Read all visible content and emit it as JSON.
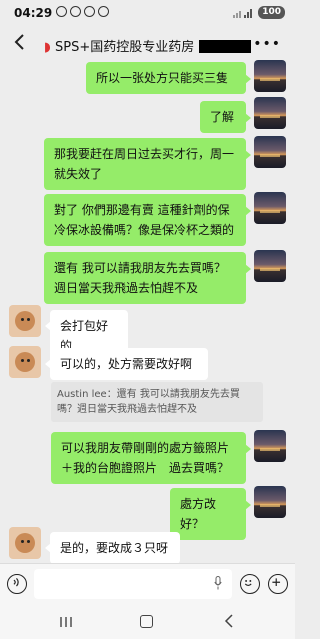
{
  "status_bar": {
    "time": "04:29",
    "battery": "100"
  },
  "header": {
    "title": "SPS+国药控股专业药房"
  },
  "messages": [
    {
      "side": "right",
      "text": "所以一张处方只能买三隻"
    },
    {
      "side": "right",
      "text": "了解"
    },
    {
      "side": "right",
      "text": "那我要赶在周日过去买才行，周一就失效了"
    },
    {
      "side": "right",
      "text": "對了 你們那邊有賣 這種針劑的保冷保冰設備嗎？像是保冷杯之類的"
    },
    {
      "side": "right",
      "text": "還有 我可以請我朋友先去買嗎？週日當天我飛過去怕趕不及"
    },
    {
      "side": "left",
      "text": "会打包好的"
    },
    {
      "side": "left",
      "text": "可以的，处方需要改好啊"
    },
    {
      "side": "right",
      "text": "可以我朋友帶剛剛的處方籤照片＋我的台胞證照片　過去買嗎？"
    },
    {
      "side": "right",
      "text": "處方改好？"
    },
    {
      "side": "left",
      "text": "是的，要改成３只呀"
    }
  ],
  "quote": {
    "text": "Austin lee：還有 我可以請我朋友先去買嗎？週日當天我飛過去怕趕不及"
  },
  "colors": {
    "sent_bubble": "#95ec69",
    "received_bubble": "#ffffff",
    "background": "#ededed"
  }
}
